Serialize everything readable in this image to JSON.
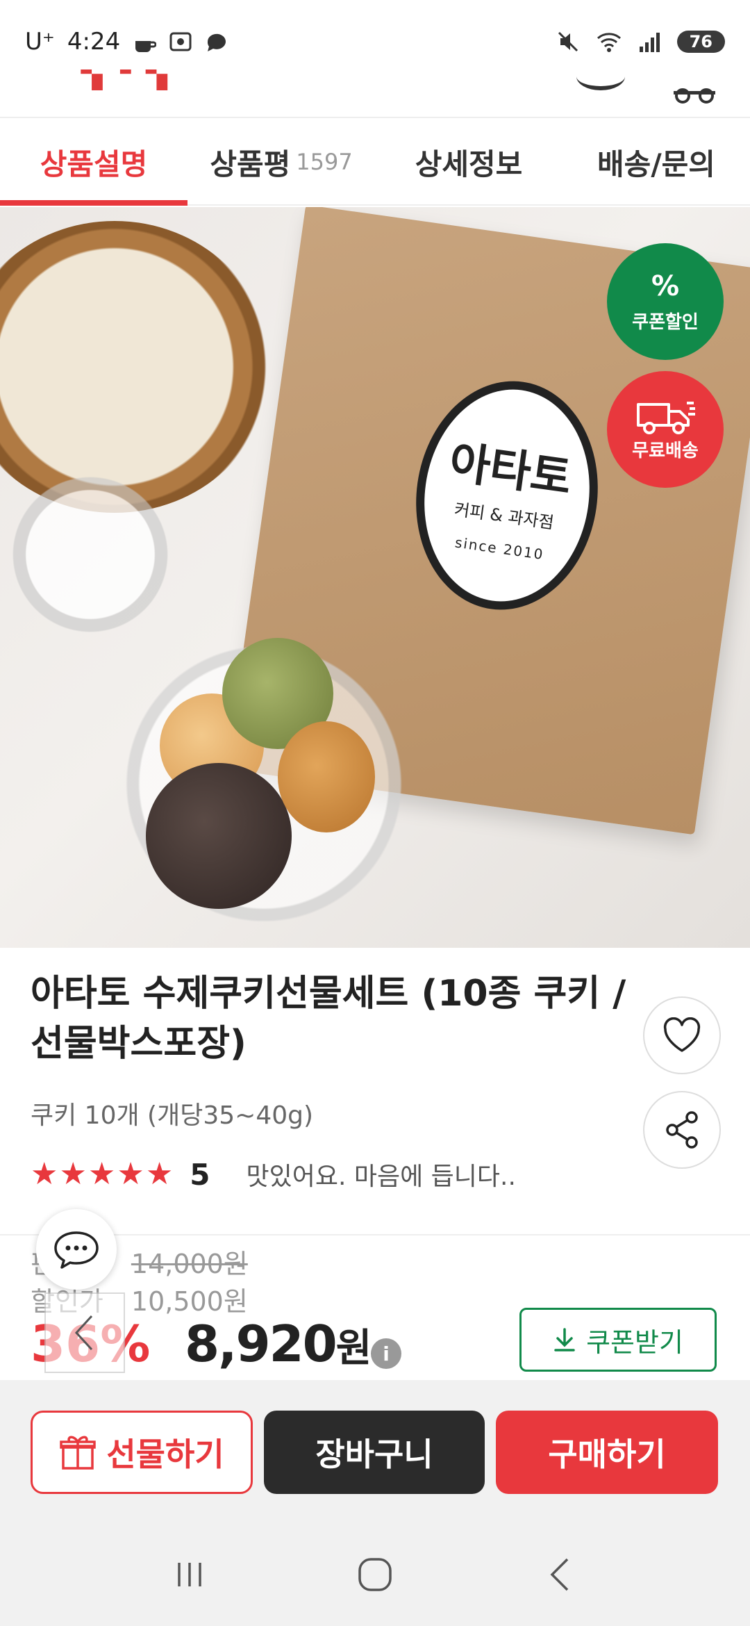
{
  "status_bar": {
    "carrier": "U⁺",
    "time": "4:24",
    "battery": "76"
  },
  "tabs": [
    {
      "label": "상품설명",
      "count": ""
    },
    {
      "label": "상품평",
      "count": "1597"
    },
    {
      "label": "상세정보",
      "count": ""
    },
    {
      "label": "배송/문의",
      "count": ""
    }
  ],
  "hero": {
    "badge_coupon": "쿠폰할인",
    "badge_coupon_symbol": "%",
    "badge_shipping": "무료배송",
    "sticker_brand": "아타토",
    "sticker_sub": "커피 & 과자점",
    "sticker_since": "since 2010"
  },
  "product": {
    "title": "아타토 수제쿠키선물세트 (10종 쿠키 / 선물박스포장)",
    "option": "쿠키 10개 (개당35~40g)",
    "rating": 5,
    "review_snippet": "맛있어요. 마음에 듭니다.."
  },
  "price": {
    "list_label": "판매가",
    "list_price": "14,000원",
    "discount_label": "할인가",
    "discount_price": "10,500원",
    "percent": "36%",
    "final_price": "8,920",
    "final_unit": "원",
    "info_icon": "i",
    "coupon_button": "쿠폰받기"
  },
  "actions": {
    "gift": "선물하기",
    "cart": "장바구니",
    "buy": "구매하기"
  },
  "colors": {
    "accent": "#e8383d",
    "coupon_green": "#118a4a",
    "dark_button": "#2b2b2b"
  },
  "icons": [
    "mute-icon",
    "wifi-icon",
    "signal-icon",
    "heart-icon",
    "share-icon",
    "chat-icon",
    "back-arrow-icon",
    "gift-icon",
    "download-icon",
    "recent-apps-icon",
    "home-icon",
    "back-icon"
  ]
}
